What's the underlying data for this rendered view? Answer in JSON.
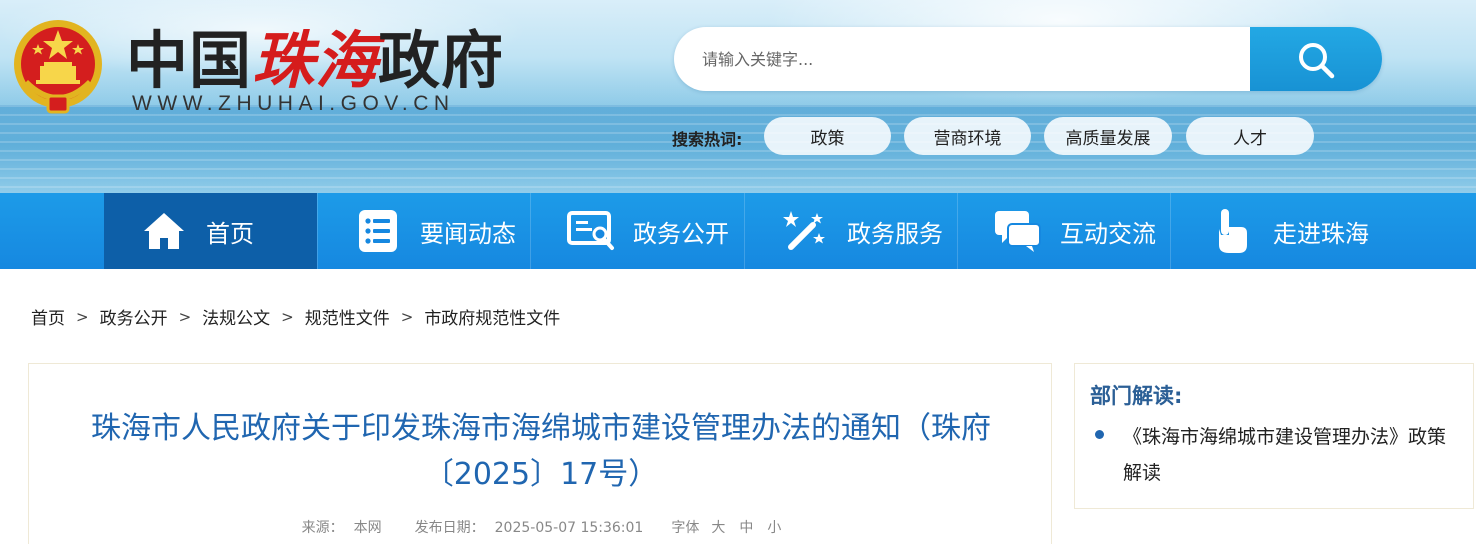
{
  "header": {
    "title_part1": "中国",
    "title_part2": "珠海",
    "title_part3": "政府",
    "url_text": "WWW.ZHUHAI.GOV.CN",
    "emblem_icon": "national-emblem-icon"
  },
  "search": {
    "placeholder": "请输入关键字...",
    "button_icon": "search-icon",
    "hot_label": "搜索热词:",
    "hot_tags": [
      "政策",
      "营商环境",
      "高质量发展",
      "人才"
    ]
  },
  "nav": {
    "items": [
      {
        "label": "首页",
        "icon": "home-icon"
      },
      {
        "label": "要闻动态",
        "icon": "news-list-icon"
      },
      {
        "label": "政务公开",
        "icon": "gov-open-icon"
      },
      {
        "label": "政务服务",
        "icon": "magic-wand-icon"
      },
      {
        "label": "互动交流",
        "icon": "chat-bubbles-icon"
      },
      {
        "label": "走进珠海",
        "icon": "pointing-hand-icon"
      }
    ]
  },
  "breadcrumb": {
    "items": [
      "首页",
      "政务公开",
      "法规公文",
      "规范性文件",
      "市政府规范性文件"
    ],
    "separator": ">"
  },
  "article": {
    "title": "珠海市人民政府关于印发珠海市海绵城市建设管理办法的通知（珠府〔2025〕17号）",
    "source_label": "来源：",
    "source_value": "本网",
    "date_label": "发布日期：",
    "date_value": "2025-05-07 15:36:01",
    "font_label": "字体",
    "font_large": "大",
    "font_medium": "中",
    "font_small": "小"
  },
  "side": {
    "title": "部门解读:",
    "link": "《珠海市海绵城市建设管理办法》政策解读"
  },
  "colors": {
    "nav_bg": "#1688e0",
    "nav_active": "#0d5fa8",
    "title_blue": "#2066b0",
    "brand_red": "#d51c1c"
  }
}
